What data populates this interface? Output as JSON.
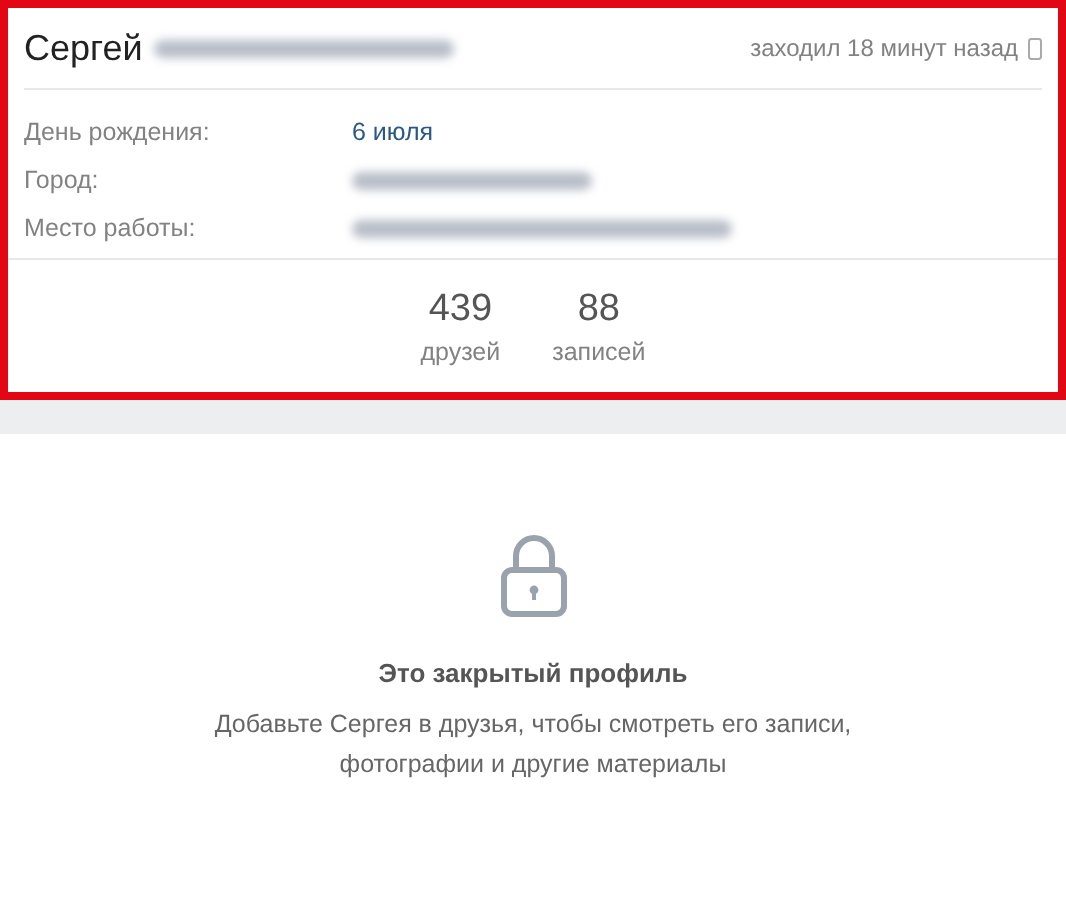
{
  "profile": {
    "highlighted": true,
    "name": "Сергей",
    "surname_blurred": true,
    "last_seen": "заходил 18 минут назад",
    "mobile": true,
    "fields": [
      {
        "label": "День рождения:",
        "value": "6 июля",
        "blurred": false
      },
      {
        "label": "Город:",
        "blurred": true
      },
      {
        "label": "Место работы:",
        "blurred": true
      }
    ],
    "counters": [
      {
        "count": "439",
        "label": "друзей"
      },
      {
        "count": "88",
        "label": "записей"
      }
    ]
  },
  "closed": {
    "title": "Это закрытый профиль",
    "text": "Добавьте Сергея в друзья, чтобы смотреть его записи, фотографии и другие материалы"
  }
}
